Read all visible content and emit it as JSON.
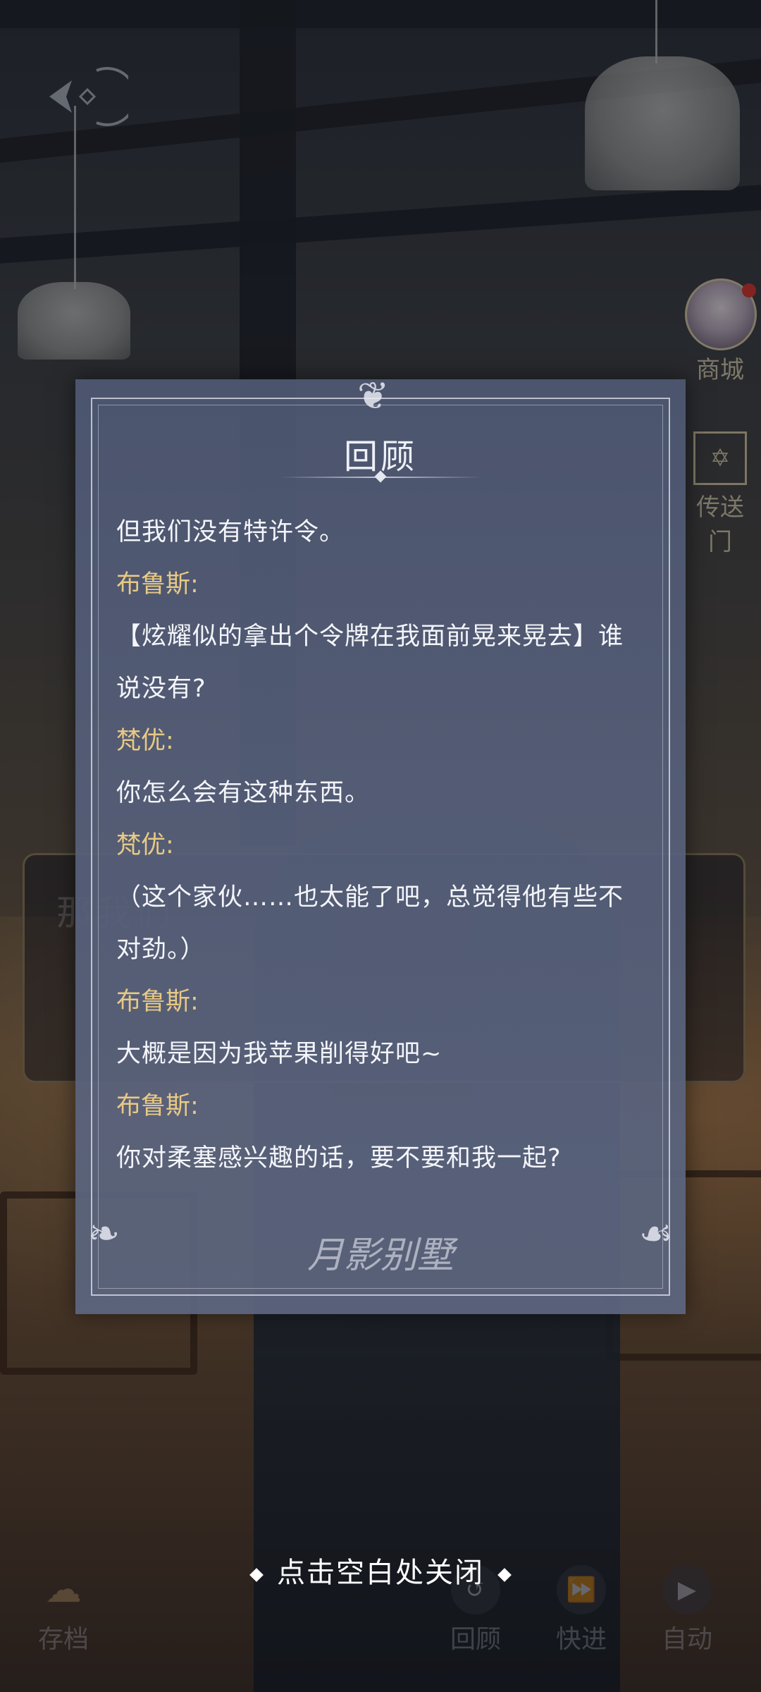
{
  "review": {
    "title": "回顾",
    "entries": [
      {
        "speaker": "",
        "text": "但我们没有特许令。"
      },
      {
        "speaker": "布鲁斯:",
        "text": ""
      },
      {
        "speaker": "",
        "text": "【炫耀似的拿出个令牌在我面前晃来晃去】谁"
      },
      {
        "speaker": "",
        "text": "说没有?"
      },
      {
        "speaker": "梵优:",
        "text": ""
      },
      {
        "speaker": "",
        "text": "你怎么会有这种东西。"
      },
      {
        "speaker": "梵优:",
        "text": ""
      },
      {
        "speaker": "",
        "text": "（这个家伙……也太能了吧，总觉得他有些不"
      },
      {
        "speaker": "",
        "text": "对劲。）"
      },
      {
        "speaker": "布鲁斯:",
        "text": ""
      },
      {
        "speaker": "",
        "text": "大概是因为我苹果削得好吧~"
      },
      {
        "speaker": "布鲁斯:",
        "text": ""
      },
      {
        "speaker": "",
        "text": "你对柔塞感兴趣的话，要不要和我一起?"
      }
    ],
    "logo_text": "月影别墅"
  },
  "close_hint": "点击空白处关闭",
  "side": {
    "shop_label": "商城",
    "portal_label": "传送门"
  },
  "bottom": {
    "save_label": "存档",
    "review_label": "回顾",
    "skip_label": "快进",
    "auto_label": "自动"
  },
  "under_dialog_text": "那我们",
  "colors": {
    "speaker": "#e8c985",
    "text": "#f4f5fa",
    "panel": "#56607a"
  }
}
